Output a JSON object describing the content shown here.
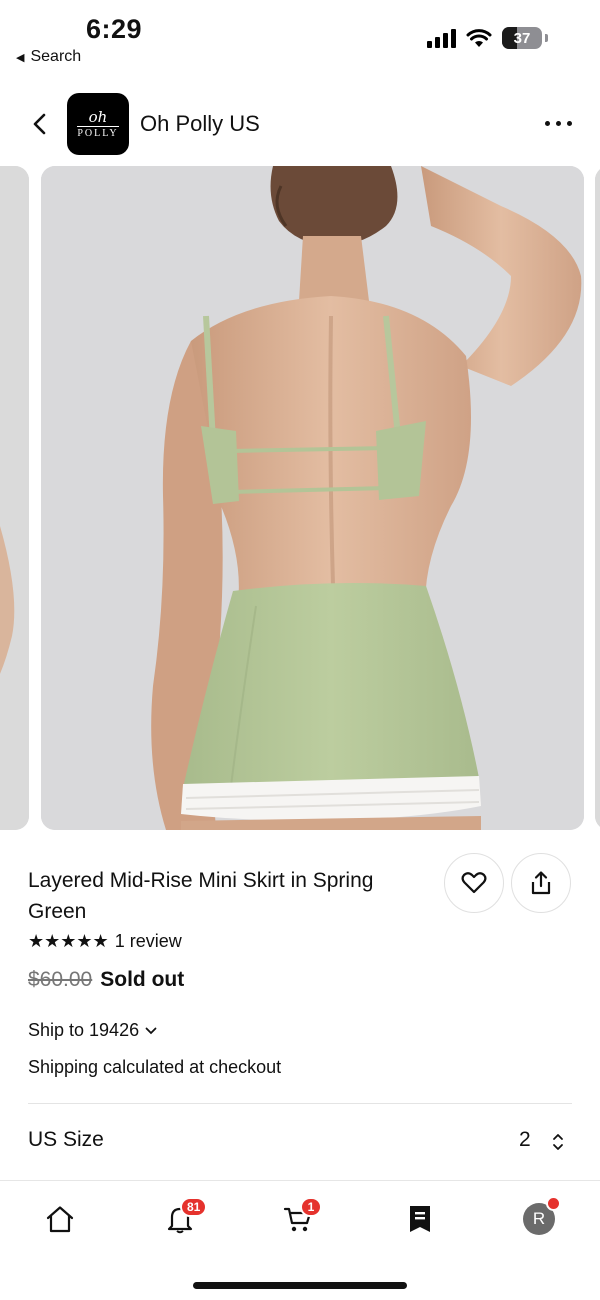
{
  "status_bar": {
    "time": "6:29",
    "back_app_label": "Search",
    "battery_level": "37",
    "battery_fraction": 0.37
  },
  "header": {
    "shop_name": "Oh Polly US",
    "logo_line1": "oh",
    "logo_line2": "POLLY",
    "back_icon": "chevron-left-icon",
    "more_icon": "more-horizontal-icon"
  },
  "product": {
    "title": "Layered Mid-Rise Mini Skirt in Spring Green",
    "rating": 5,
    "stars": "★★★★★",
    "review_count": "1 review",
    "price": "$60.00",
    "availability": "Sold out",
    "ship_to": "Ship to 19426",
    "shipping_note": "Shipping calculated at checkout",
    "size_label": "US Size",
    "size_value": "2"
  },
  "colors": {
    "badge": "#e5322d",
    "skirt": "#b5c79a",
    "background": "#d8d8da"
  },
  "tabbar": {
    "items": [
      {
        "name": "home",
        "icon": "home-icon"
      },
      {
        "name": "notifications",
        "icon": "bell-icon",
        "badge": "81"
      },
      {
        "name": "cart",
        "icon": "cart-icon",
        "badge": "1"
      },
      {
        "name": "orders",
        "icon": "receipt-icon"
      },
      {
        "name": "profile",
        "icon": "avatar",
        "initial": "R"
      }
    ]
  }
}
